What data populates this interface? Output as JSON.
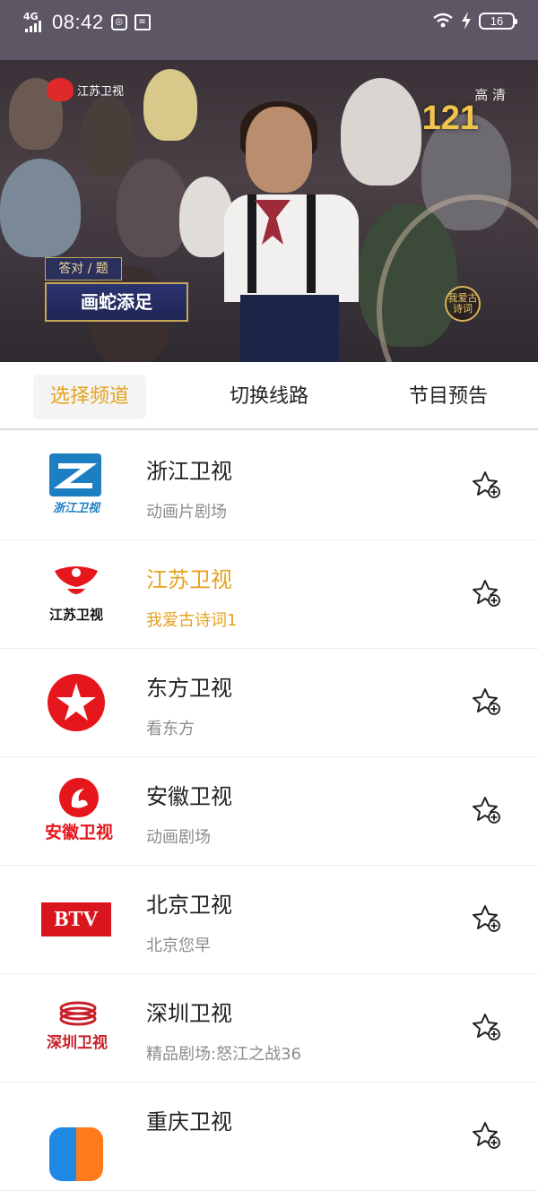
{
  "status_bar": {
    "network": "4G",
    "time": "08:42",
    "battery": "16"
  },
  "video": {
    "channel_logo_text": "江苏卫视",
    "quality": "高 清",
    "score": "121",
    "question_tag": "答对 / 题",
    "answer_text": "画蛇添足",
    "seal_text": "我爱古诗词"
  },
  "tabs": [
    {
      "label": "选择频道",
      "active": true
    },
    {
      "label": "切换线路",
      "active": false
    },
    {
      "label": "节目预告",
      "active": false
    }
  ],
  "channels": [
    {
      "name": "浙江卫视",
      "program": "动画片剧场",
      "logo": "zhejiang-tv-logo",
      "logo_text": "浙江卫视"
    },
    {
      "name": "江苏卫视",
      "program": "我爱古诗词1",
      "logo": "jiangsu-tv-logo",
      "logo_text": "江苏卫视",
      "active": true
    },
    {
      "name": "东方卫视",
      "program": "看东方",
      "logo": "dragon-tv-logo"
    },
    {
      "name": "安徽卫视",
      "program": "动画剧场",
      "logo": "anhui-tv-logo",
      "logo_text": "安徽卫视"
    },
    {
      "name": "北京卫视",
      "program": "北京您早",
      "logo": "btv-logo",
      "logo_text": "BTV"
    },
    {
      "name": "深圳卫视",
      "program": "精品剧场:怒江之战36",
      "logo": "shenzhen-tv-logo",
      "logo_text": "深圳卫视"
    },
    {
      "name": "重庆卫视",
      "program": "",
      "logo": "chongqing-tv-logo"
    }
  ],
  "colors": {
    "accent": "#e5a21f",
    "status_bar": "#5d5765"
  }
}
